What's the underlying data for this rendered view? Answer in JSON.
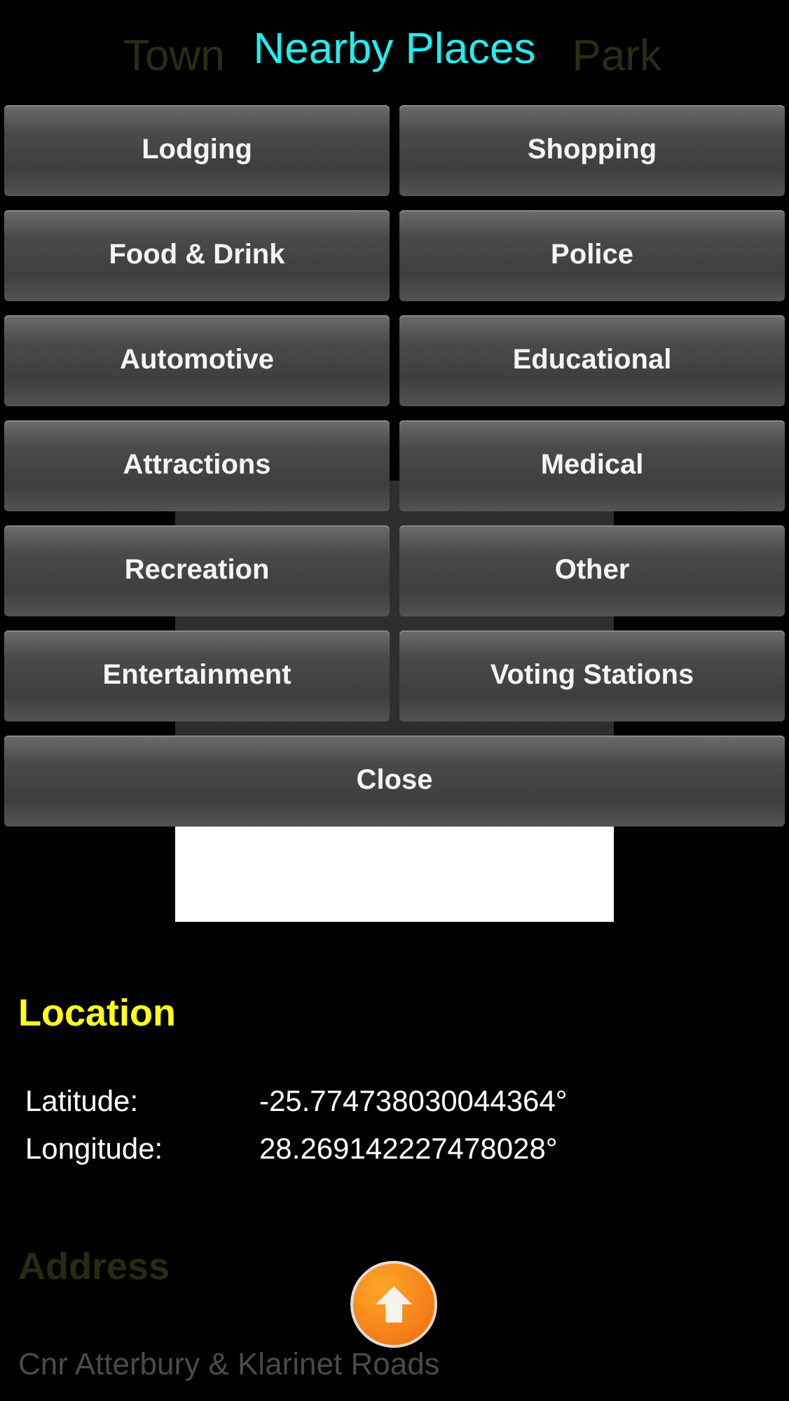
{
  "background_page": {
    "title_left": "Town",
    "title_right": "Park",
    "location": {
      "heading": "Location",
      "rows": [
        {
          "label": "Latitude:",
          "value": "-25.774738030044364°"
        },
        {
          "label": "Longitude:",
          "value": "28.269142227478028°"
        }
      ]
    },
    "address": {
      "heading": "Address",
      "line": "Cnr Atterbury & Klarinet Roads"
    }
  },
  "dialog": {
    "title": "Nearby Places",
    "buttons": [
      "Lodging",
      "Shopping",
      "Food & Drink",
      "Police",
      "Automotive",
      "Educational",
      "Attractions",
      "Medical",
      "Recreation",
      "Other",
      "Entertainment",
      "Voting Stations"
    ],
    "close": "Close"
  }
}
